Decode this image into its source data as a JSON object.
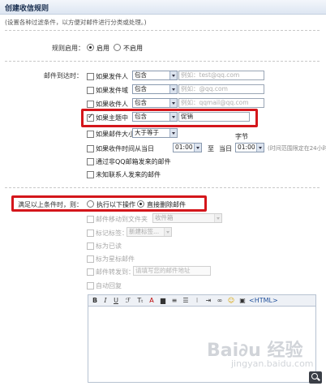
{
  "title": "创建收信规则",
  "hint": "(设置各种过滤条件，以方便对邮件进行分类或处理。)",
  "rule_enabled": {
    "label": "规则启用：",
    "on_label": "启用",
    "off_label": "不启用",
    "selected": "启用"
  },
  "conditions": {
    "label": "邮件到达时：",
    "sender": {
      "label": "如果发件人",
      "op": "包含",
      "placeholder": "例如：test@qq.com",
      "checked": false
    },
    "sender_domain": {
      "label": "如果发件域",
      "op": "包含",
      "placeholder": "例如：@qq.com",
      "checked": false
    },
    "recipient": {
      "label": "如果收件人",
      "op": "包含",
      "placeholder": "例如：qqmail@qq.com",
      "checked": false
    },
    "subject": {
      "label": "如果主题中",
      "op": "包含",
      "value": "促销",
      "checked": true
    },
    "size": {
      "label": "如果邮件大小",
      "op": "大于等于",
      "unit": "字节",
      "checked": false
    },
    "time": {
      "label": "如果收件时间从当日",
      "from": "01:00",
      "to_label": "至",
      "day_label": "当日",
      "to": "01:00",
      "note": "(时间范围限定在24小时内)",
      "checked": false
    },
    "qqmail": {
      "label": "通过非QQ邮箱发来的邮件",
      "checked": false
    },
    "unknown": {
      "label": "未知联系人发来的邮件",
      "checked": false
    }
  },
  "actions": {
    "label": "满足以上条件时，则：",
    "execute_label": "执行以下操作",
    "delete_label": "直接删除邮件",
    "selected": "直接删除邮件",
    "move": {
      "label": "邮件移动到文件夹",
      "select": "收件箱"
    },
    "tag": {
      "label": "标记标签：",
      "select": "新建标签..."
    },
    "mark_read": {
      "label": "标为已读"
    },
    "mark_star": {
      "label": "标为星标邮件"
    },
    "forward": {
      "label": "邮件转发到：",
      "placeholder": "请填写您的邮件地址"
    },
    "auto_reply": {
      "label": "自动回复"
    }
  },
  "toolbar": {
    "bold": "B",
    "italic": "I",
    "underline": "U",
    "html": "<HTML>"
  },
  "colors": {
    "highlight": "#d4161b",
    "header_bg": "#dde6f2"
  }
}
